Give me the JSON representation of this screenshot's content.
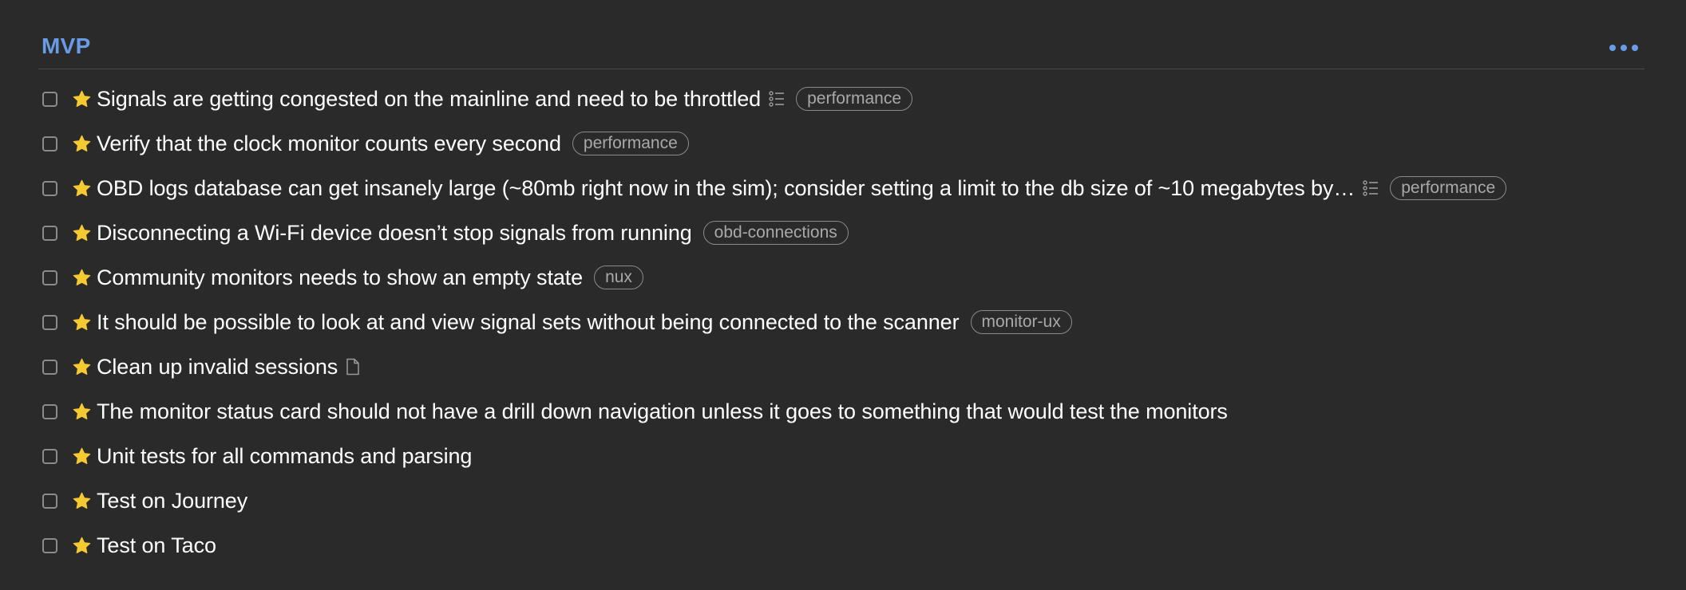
{
  "section": {
    "title": "MVP",
    "more_icon": "ellipsis-icon",
    "accent_color": "#6a9be7"
  },
  "tasks": [
    {
      "title": "Signals are getting congested on the mainline and need to be throttled",
      "starred": true,
      "meta_icon": "checklist-icon",
      "tag": "performance"
    },
    {
      "title": "Verify that the clock monitor counts every second",
      "starred": true,
      "meta_icon": "",
      "tag": "performance"
    },
    {
      "title": "OBD logs database can get insanely large (~80mb right now in the sim); consider setting a limit to the db size of ~10 megabytes by…",
      "starred": true,
      "meta_icon": "checklist-icon",
      "tag": "performance"
    },
    {
      "title": "Disconnecting a Wi-Fi device doesn’t stop signals from running",
      "starred": true,
      "meta_icon": "",
      "tag": "obd-connections"
    },
    {
      "title": "Community monitors needs to show an empty state",
      "starred": true,
      "meta_icon": "",
      "tag": "nux"
    },
    {
      "title": "It should be possible to look at and view signal sets without being connected to the scanner",
      "starred": true,
      "meta_icon": "",
      "tag": "monitor-ux"
    },
    {
      "title": "Clean up invalid sessions",
      "starred": true,
      "meta_icon": "note-icon",
      "tag": ""
    },
    {
      "title": "The monitor status card should not have a drill down navigation unless it goes to something that would test the monitors",
      "starred": true,
      "meta_icon": "",
      "tag": ""
    },
    {
      "title": "Unit tests for all commands and parsing",
      "starred": true,
      "meta_icon": "",
      "tag": ""
    },
    {
      "title": "Test on Journey",
      "starred": true,
      "meta_icon": "",
      "tag": ""
    },
    {
      "title": "Test on Taco",
      "starred": true,
      "meta_icon": "",
      "tag": ""
    }
  ],
  "colors": {
    "background": "#2a2a2a",
    "star": "#f5c932",
    "tag_text": "#a9a9a9",
    "tag_border": "#8a8a8a"
  }
}
